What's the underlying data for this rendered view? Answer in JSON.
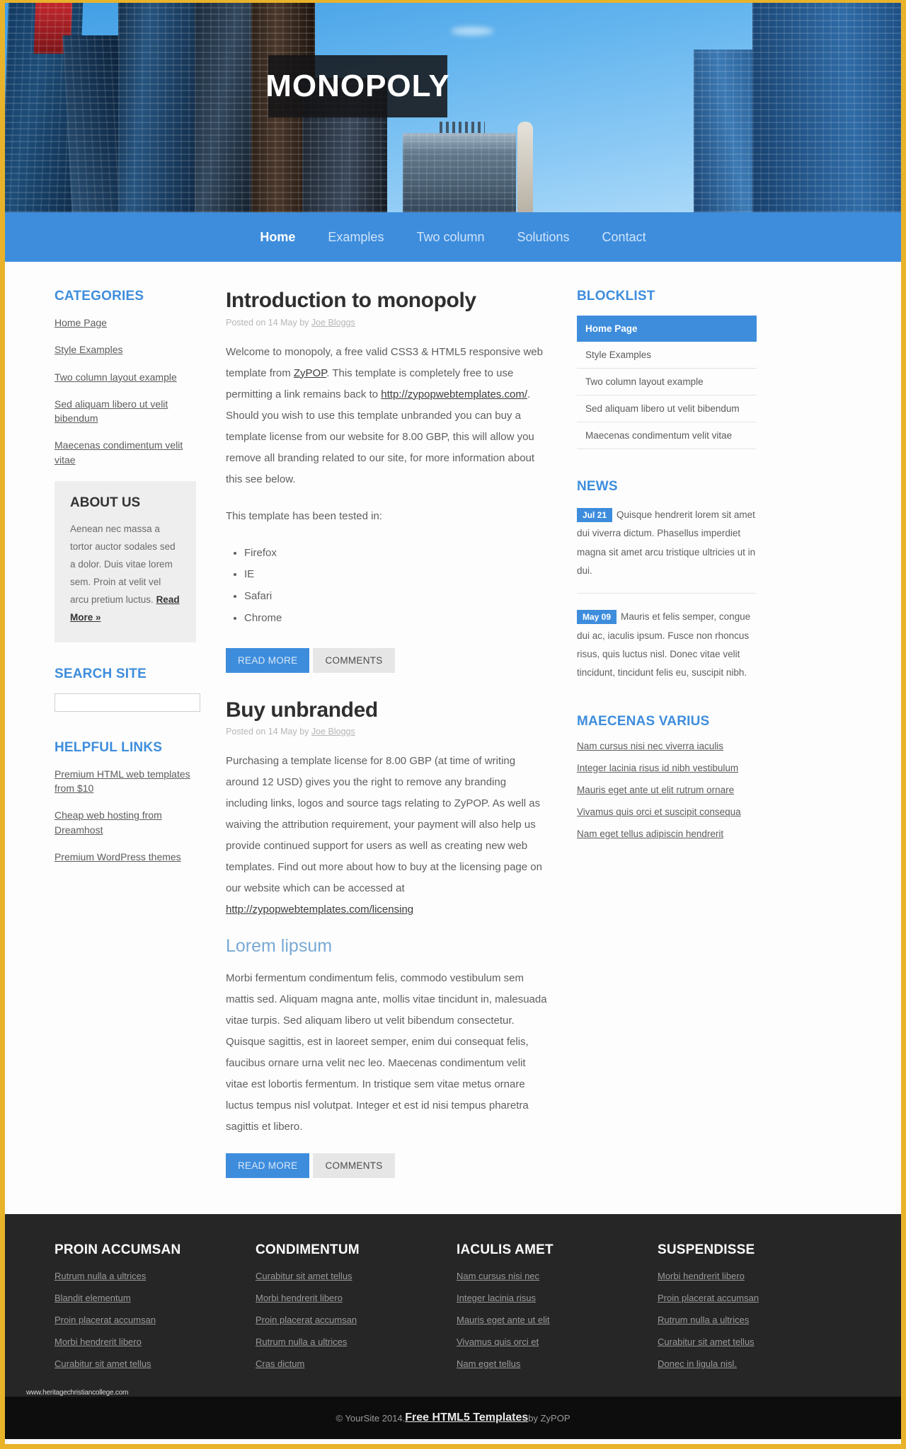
{
  "site": {
    "logo_text": "MONOPOLY"
  },
  "nav": {
    "items": [
      {
        "label": "Home",
        "active": true
      },
      {
        "label": "Examples",
        "active": false
      },
      {
        "label": "Two column",
        "active": false
      },
      {
        "label": "Solutions",
        "active": false
      },
      {
        "label": "Contact",
        "active": false
      }
    ]
  },
  "sidebar_left": {
    "categories": {
      "title": "CATEGORIES",
      "items": [
        "Home Page",
        "Style Examples",
        "Two column layout example",
        "Sed aliquam libero ut velit bibendum",
        "Maecenas condimentum velit vitae"
      ]
    },
    "about": {
      "title": "ABOUT US",
      "text": "Aenean nec massa a tortor auctor sodales sed a dolor. Duis vitae lorem sem. Proin at velit vel arcu pretium luctus.",
      "read_more": "Read More »"
    },
    "search": {
      "title": "SEARCH SITE",
      "value": "",
      "placeholder": ""
    },
    "helpful": {
      "title": "HELPFUL LINKS",
      "items": [
        "Premium HTML web templates from $10",
        "Cheap web hosting from Dreamhost",
        "Premium WordPress themes"
      ]
    }
  },
  "main": {
    "posts": [
      {
        "title": "Introduction to monopoly",
        "meta_prefix": "Posted on 14 May by ",
        "meta_author": "Joe Bloggs",
        "paragraph_1a": "Welcome to monopoly, a free valid CSS3 & HTML5 responsive web template from ",
        "link_1": "ZyPOP",
        "paragraph_1b": ". This template is completely free to use permitting a link remains back to ",
        "link_2": "http://zypopwebtemplates.com/",
        "paragraph_1c": ". Should you wish to use this template unbranded you can buy a template license from our website for 8.00 GBP, this will allow you remove all branding related to our site, for more information about this see below.",
        "tested_label": "This template has been tested in:",
        "browsers": [
          "Firefox",
          "IE",
          "Safari",
          "Chrome"
        ],
        "btn_primary": "READ MORE",
        "btn_default": "COMMENTS"
      },
      {
        "title": "Buy unbranded",
        "meta_prefix": "Posted on 14 May by ",
        "meta_author": "Joe Bloggs",
        "paragraph_2a": "Purchasing a template license for 8.00 GBP (at time of writing around 12 USD) gives you the right to remove any branding including links, logos and source tags relating to ZyPOP. As well as waiving the attribution requirement, your payment will also help us provide continued support for users as well as creating new web templates. Find out more about how to buy at the licensing page on our website which can be accessed at ",
        "link_3": "http://zypopwebtemplates.com/licensing",
        "sub_title": "Lorem lipsum",
        "paragraph_3": "Morbi fermentum condimentum felis, commodo vestibulum sem mattis sed. Aliquam magna ante, mollis vitae tincidunt in, malesuada vitae turpis. Sed aliquam libero ut velit bibendum consectetur. Quisque sagittis, est in laoreet semper, enim dui consequat felis, faucibus ornare urna velit nec leo. Maecenas condimentum velit vitae est lobortis fermentum. In tristique sem vitae metus ornare luctus tempus nisl volutpat. Integer et est id nisi tempus pharetra sagittis et libero.",
        "btn_primary": "READ MORE",
        "btn_default": "COMMENTS"
      }
    ]
  },
  "sidebar_right": {
    "blocklist": {
      "title": "BLOCKLIST",
      "items": [
        {
          "label": "Home Page",
          "active": true
        },
        {
          "label": "Style Examples",
          "active": false
        },
        {
          "label": "Two column layout example",
          "active": false
        },
        {
          "label": "Sed aliquam libero ut velit bibendum",
          "active": false
        },
        {
          "label": "Maecenas condimentum velit vitae",
          "active": false
        }
      ]
    },
    "news": {
      "title": "NEWS",
      "items": [
        {
          "date": "Jul 21",
          "text": "Quisque hendrerit lorem sit amet dui viverra dictum. Phasellus imperdiet magna sit amet arcu tristique ultricies ut in dui."
        },
        {
          "date": "May 09",
          "text": "Mauris et felis semper, congue dui ac, iaculis ipsum. Fusce non rhoncus risus, quis luctus nisl. Donec vitae velit tincidunt, tincidunt felis eu, suscipit nibh."
        }
      ]
    },
    "varius": {
      "title": "MAECENAS VARIUS",
      "items": [
        "Nam cursus nisi nec viverra iaculis",
        "Integer lacinia risus id nibh vestibulum",
        "Mauris eget ante ut elit rutrum ornare",
        "Vivamus quis orci et suscipit consequa",
        "Nam eget tellus adipiscin hendrerit"
      ]
    }
  },
  "footer": {
    "columns": [
      {
        "title": "PROIN ACCUMSAN",
        "links": [
          "Rutrum nulla a ultrices",
          "Blandit elementum",
          "Proin placerat accumsan",
          "Morbi hendrerit libero",
          "Curabitur sit amet tellus"
        ]
      },
      {
        "title": "CONDIMENTUM",
        "links": [
          "Curabitur sit amet tellus",
          "Morbi hendrerit libero",
          "Proin placerat accumsan",
          "Rutrum nulla a ultrices",
          "Cras dictum"
        ]
      },
      {
        "title": "IACULIS AMET",
        "links": [
          "Nam cursus nisi nec",
          "Integer lacinia risus",
          "Mauris eget ante ut elit",
          "Vivamus quis orci et",
          "Nam eget tellus"
        ]
      },
      {
        "title": "SUSPENDISSE",
        "links": [
          "Morbi hendrerit libero",
          "Proin placerat accumsan",
          "Rutrum nulla a ultrices",
          "Curabitur sit amet tellus",
          "Donec in ligula nisl."
        ]
      }
    ],
    "copyright_prefix": "© YourSite 2014. ",
    "copyright_link": "Free HTML5 Templates",
    "copyright_suffix": " by ZyPOP",
    "watermark": "www.heritagechristiancollege.com"
  },
  "colors": {
    "accent_blue": "#3e8ddd",
    "border_gold": "#e8b32a",
    "footer_dark": "#262626",
    "copybar_dark": "#0d0d0d",
    "subtitle_blue": "#78a9d4"
  }
}
